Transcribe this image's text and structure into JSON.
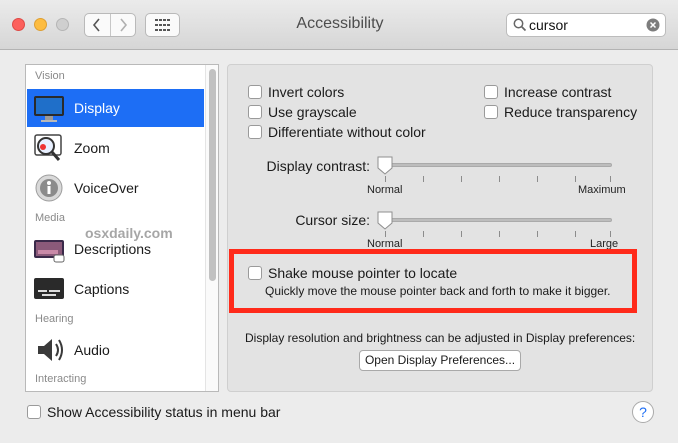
{
  "window": {
    "title": "Accessibility"
  },
  "search": {
    "value": "cursor"
  },
  "sidebar": {
    "sections": [
      "Vision",
      "Media",
      "Hearing",
      "Interacting"
    ],
    "items": [
      {
        "label": "Display",
        "icon": "display-icon",
        "selected": true
      },
      {
        "label": "Zoom",
        "icon": "zoom-icon",
        "selected": false
      },
      {
        "label": "VoiceOver",
        "icon": "voiceover-icon",
        "selected": false
      },
      {
        "label": "Descriptions",
        "icon": "descriptions-icon",
        "selected": false
      },
      {
        "label": "Captions",
        "icon": "captions-icon",
        "selected": false
      },
      {
        "label": "Audio",
        "icon": "audio-icon",
        "selected": false
      }
    ],
    "watermark": "osxdaily.com"
  },
  "display": {
    "checkboxes": {
      "invert_colors": "Invert colors",
      "use_grayscale": "Use grayscale",
      "differentiate": "Differentiate without color",
      "increase_contrast": "Increase contrast",
      "reduce_transparency": "Reduce transparency"
    },
    "contrast": {
      "label": "Display contrast:",
      "min_label": "Normal",
      "max_label": "Maximum",
      "value": 0
    },
    "cursor_size": {
      "label": "Cursor size:",
      "min_label": "Normal",
      "max_label": "Large",
      "value": 0
    },
    "shake": {
      "label": "Shake mouse pointer to locate",
      "description": "Quickly move the mouse pointer back and forth to make it bigger."
    },
    "note": "Display resolution and brightness can be adjusted in Display preferences:",
    "open_button": "Open Display Preferences..."
  },
  "footer": {
    "status_checkbox": "Show Accessibility status in menu bar",
    "help": "?"
  },
  "colors": {
    "selection": "#1d6ef5",
    "highlight": "#ff2a1a"
  }
}
